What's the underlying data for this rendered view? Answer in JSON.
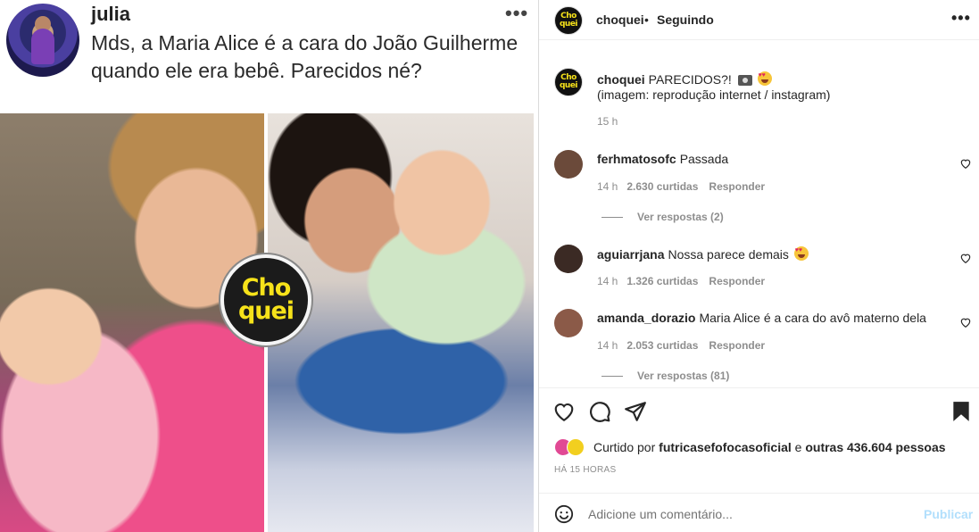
{
  "tweet": {
    "username": "julia",
    "more_label": "•••",
    "text": "Mds, a Maria Alice é a cara do João Guilherme quando ele era bebê. Parecidos né?"
  },
  "logo": {
    "line1": "Cho",
    "line2": "quei"
  },
  "header": {
    "username": "choquei",
    "separator": "•",
    "follow_status": "Seguindo",
    "more_label": "•••"
  },
  "caption": {
    "username": "choquei",
    "text": "PARECIDOS?!",
    "credit": "(imagem: reprodução internet / instagram)",
    "time": "15 h"
  },
  "comments": [
    {
      "username": "ferhmatosofc",
      "text": "Passada",
      "time": "14 h",
      "likes": "2.630 curtidas",
      "reply_label": "Responder",
      "view_replies": "Ver respostas (2)",
      "avatar_color": "#6b4a3a"
    },
    {
      "username": "aguiarrjana",
      "text": "Nossa parece demais",
      "time": "14 h",
      "likes": "1.326 curtidas",
      "reply_label": "Responder",
      "view_replies": "",
      "avatar_color": "#3b2a24"
    },
    {
      "username": "amanda_dorazio",
      "text": "Maria Alice é a cara do avô materno dela",
      "time": "14 h",
      "likes": "2.053 curtidas",
      "reply_label": "Responder",
      "view_replies": "Ver respostas (81)",
      "avatar_color": "#8b5a48"
    }
  ],
  "likes": {
    "prefix": "Curtido por",
    "user": "futricasefofocasoficial",
    "connector": "e",
    "others": "outras 436.604 pessoas"
  },
  "post_time": "HÁ 15 HORAS",
  "comment_box": {
    "placeholder": "Adicione um comentário...",
    "post_label": "Publicar"
  },
  "icons": {
    "like": "heart-icon",
    "comment": "comment-icon",
    "share": "send-icon",
    "save": "bookmark-icon",
    "emoji": "emoji-icon"
  }
}
